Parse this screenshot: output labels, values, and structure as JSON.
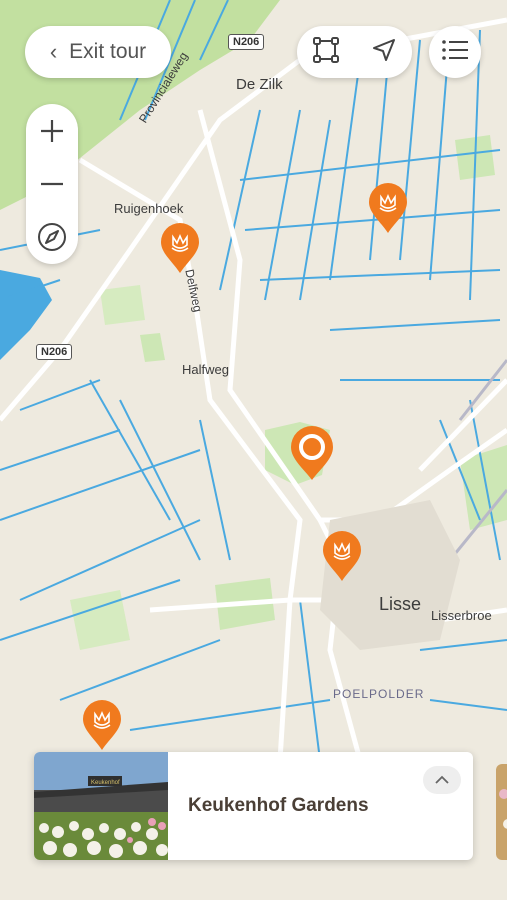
{
  "header": {
    "exit_label": "Exit tour",
    "tools": [
      "area-select-icon",
      "navigate-icon"
    ],
    "menu_icon": "list-icon"
  },
  "zoom": {
    "in_icon": "plus-icon",
    "out_icon": "minus-icon",
    "compass_icon": "compass-icon"
  },
  "map": {
    "labels": {
      "de_zilk": "De Zilk",
      "ruigenhoek": "Ruigenhoek",
      "halfweg": "Halfweg",
      "lisse": "Lisse",
      "lisserbroek": "Lisserbroe",
      "poelpolder": "POELPOLDER",
      "provincialeweg": "Provincialeweg",
      "delfweg": "Delfweg"
    },
    "shields": {
      "n206_top": "N206",
      "n206_left": "N206"
    },
    "colors": {
      "land": "#eeeadf",
      "water": "#4aa9e0",
      "green": "#cde7b5",
      "forest": "#c2e0a0",
      "pin": "#f07a1e"
    }
  },
  "pins": [
    "tulip-marker",
    "tulip-marker",
    "current-stop-marker",
    "tulip-marker",
    "tulip-marker"
  ],
  "card": {
    "title": "Keukenhof Gardens",
    "image_sign": "Keukenhof",
    "expand_icon": "chevron-up-icon"
  }
}
